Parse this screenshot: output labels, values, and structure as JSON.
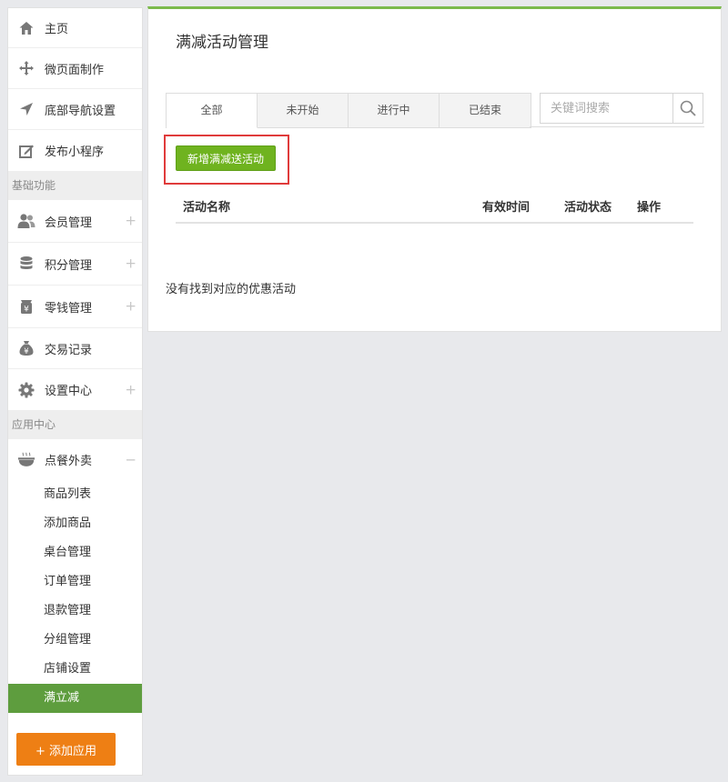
{
  "sidebar": {
    "top_items": [
      {
        "label": "主页",
        "icon": "home-icon"
      },
      {
        "label": "微页面制作",
        "icon": "move-icon"
      },
      {
        "label": "底部导航设置",
        "icon": "navigation-arrow-icon"
      },
      {
        "label": "发布小程序",
        "icon": "edit-icon"
      }
    ],
    "section_basic": "基础功能",
    "basic_items": [
      {
        "label": "会员管理",
        "icon": "users-icon",
        "expand": "+"
      },
      {
        "label": "积分管理",
        "icon": "database-icon",
        "expand": "+"
      },
      {
        "label": "零钱管理",
        "icon": "wallet-icon",
        "expand": "+"
      },
      {
        "label": "交易记录",
        "icon": "money-bag-icon"
      },
      {
        "label": "设置中心",
        "icon": "gear-icon",
        "expand": "+"
      }
    ],
    "section_apps": "应用中心",
    "app_group": {
      "label": "点餐外卖",
      "icon": "food-bowl-icon",
      "expand": "−"
    },
    "sub_items": [
      "商品列表",
      "添加商品",
      "桌台管理",
      "订单管理",
      "退款管理",
      "分组管理",
      "店铺设置",
      "满立减"
    ],
    "active_sub": "满立减",
    "add_app_button": "+ 添加应用"
  },
  "main": {
    "title": "满减活动管理",
    "tabs": [
      "全部",
      "未开始",
      "进行中",
      "已结束"
    ],
    "active_tab": "全部",
    "search": {
      "placeholder": "关键词搜索",
      "value": ""
    },
    "add_button": "新增满减送活动",
    "columns": [
      "活动名称",
      "有效时间",
      "活动状态",
      "操作"
    ],
    "empty_message": "没有找到对应的优惠活动"
  },
  "colors": {
    "accent_green": "#7cba4d",
    "button_green": "#6fb31f",
    "active_sub_bg": "#5e9d3e",
    "orange": "#ee7f14",
    "highlight_red": "#e03b3b"
  }
}
